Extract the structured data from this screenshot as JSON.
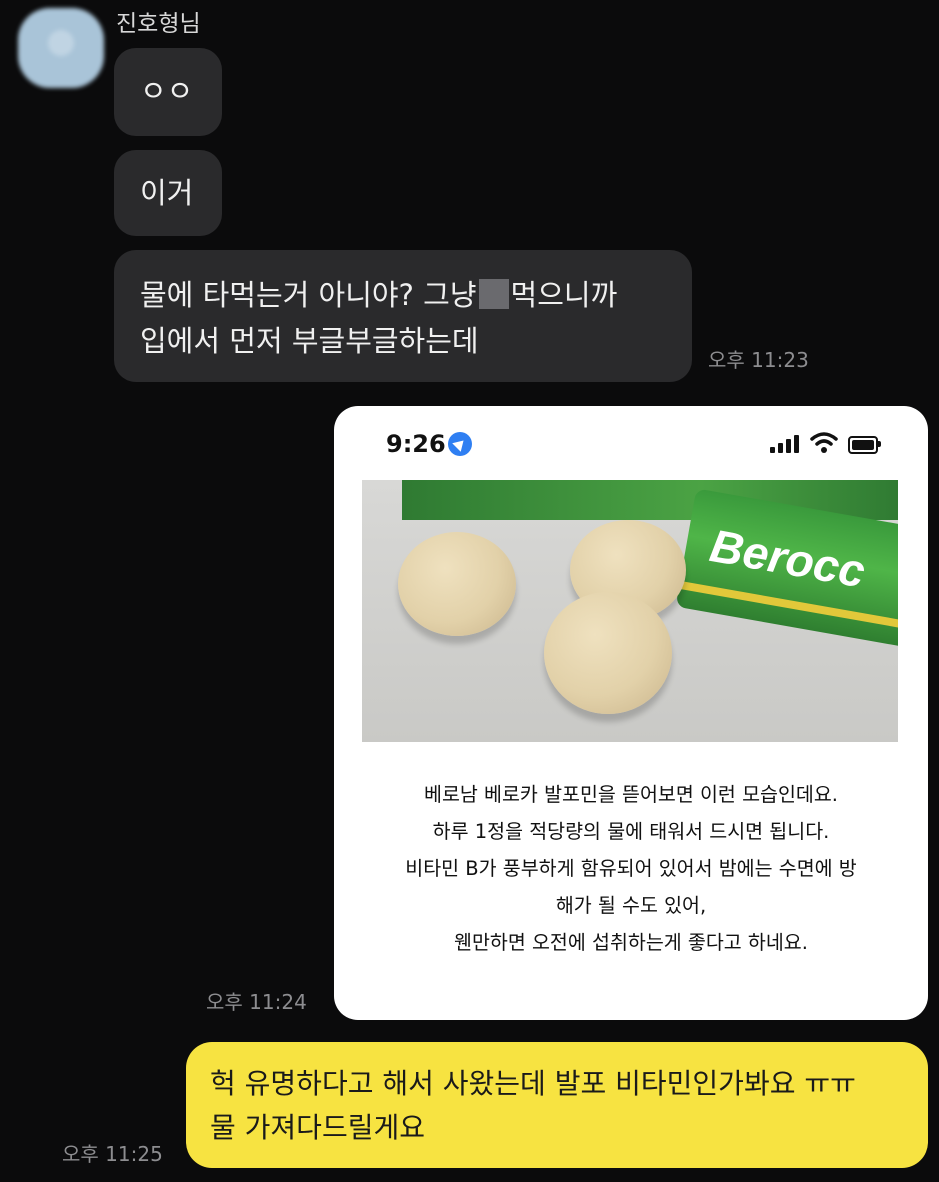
{
  "chat": {
    "sender_name": "진호형님",
    "incoming": [
      {
        "text": "ㅇㅇ"
      },
      {
        "text": "이거"
      },
      {
        "line1_a": "물에 타먹는거 아니야? 그냥",
        "line1_b": "먹으니까",
        "line2": "입에서 먼저 부글부글하는데"
      }
    ],
    "time_incoming": "오후 11:23",
    "time_card": "오후 11:24",
    "time_outgoing": "오후 11:25",
    "outgoing": {
      "line1": "헉 유명하다고 해서 사왔는데 발포 비타민인가봐요 ㅠㅠ",
      "line2": "물 가져다드릴게요"
    }
  },
  "shared_card": {
    "status_time": "9:26",
    "photo_brand_text": "Berocc",
    "caption_lines": [
      "베로남 베로카 발포민을 뜯어보면 이런 모습인데요.",
      "하루 1정을 적당량의 물에 태워서 드시면 됩니다.",
      "비타민 B가 풍부하게 함유되어 있어서 밤에는 수면에 방",
      "해가 될 수도 있어,",
      "웬만하면  오전에 섭취하는게 좋다고 하네요."
    ]
  },
  "colors": {
    "background": "#0b0b0c",
    "incoming_bubble": "#2a2a2c",
    "outgoing_bubble": "#f7e341",
    "location_icon": "#2f7ff2"
  }
}
